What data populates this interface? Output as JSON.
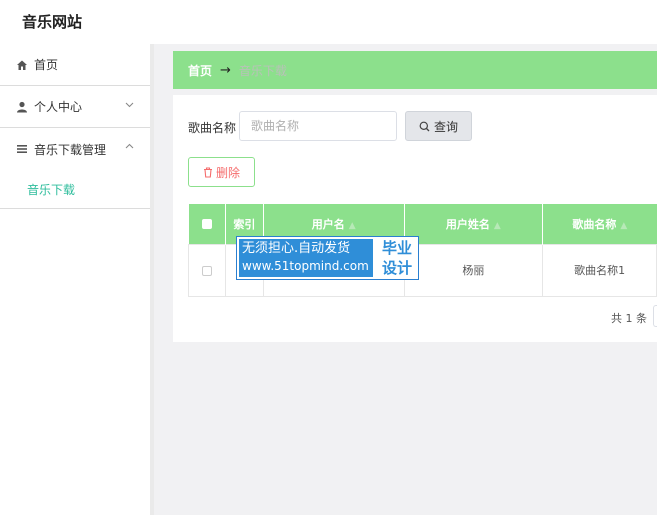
{
  "app": {
    "title": "音乐网站"
  },
  "sidebar": {
    "items": [
      {
        "label": "首页",
        "icon": "home-icon"
      },
      {
        "label": "个人中心",
        "icon": "user-icon",
        "chevron": "chevron-down-icon"
      },
      {
        "label": "音乐下载管理",
        "icon": "list-icon",
        "chevron": "chevron-up-icon"
      }
    ],
    "submenu": [
      {
        "label": "音乐下载"
      }
    ]
  },
  "breadcrumb": {
    "home": "首页",
    "arrow": "→",
    "current": "音乐下载"
  },
  "search": {
    "label": "歌曲名称",
    "placeholder": "歌曲名称",
    "button": "查询"
  },
  "toolbar": {
    "delete": "删除"
  },
  "table": {
    "columns": [
      "索引",
      "用户名",
      "用户姓名",
      "歌曲名称"
    ],
    "rows": [
      {
        "index": "",
        "username": "",
        "realname": "杨丽",
        "song": "歌曲名称1"
      }
    ]
  },
  "pagination": {
    "total_text": "共 1 条"
  },
  "watermark": {
    "line1": "无须担心.自动发货",
    "line2": "www.51topmind.com",
    "right1": "毕业",
    "right2": "设计"
  },
  "colors": {
    "accent": "#8ce08c",
    "active_menu": "#2ebd9c",
    "danger": "#f56c6c",
    "watermark": "#2f8ed8"
  }
}
